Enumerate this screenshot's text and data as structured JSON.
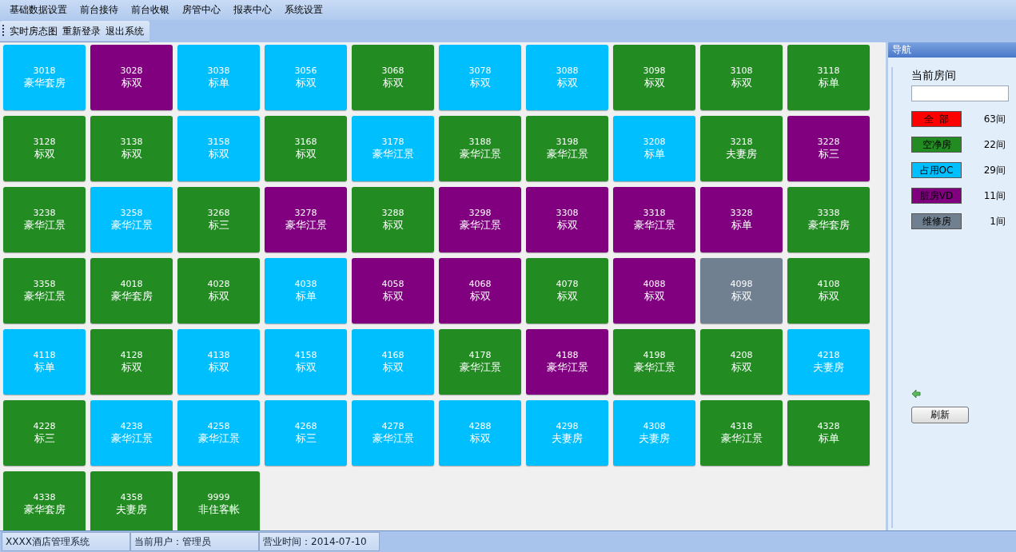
{
  "menu": [
    "基础数据设置",
    "前台接待",
    "前台收银",
    "房管中心",
    "报表中心",
    "系统设置"
  ],
  "toolbar": [
    "实时房态图",
    "重新登录",
    "退出系统"
  ],
  "rooms": [
    {
      "number": "3018",
      "type": "豪华套房",
      "kind": "occupied"
    },
    {
      "number": "3028",
      "type": "标双",
      "kind": "dirty"
    },
    {
      "number": "3038",
      "type": "标单",
      "kind": "occupied"
    },
    {
      "number": "3056",
      "type": "标双",
      "kind": "occupied"
    },
    {
      "number": "3068",
      "type": "标双",
      "kind": "clean"
    },
    {
      "number": "3078",
      "type": "标双",
      "kind": "occupied"
    },
    {
      "number": "3088",
      "type": "标双",
      "kind": "occupied"
    },
    {
      "number": "3098",
      "type": "标双",
      "kind": "clean"
    },
    {
      "number": "3108",
      "type": "标双",
      "kind": "clean"
    },
    {
      "number": "3118",
      "type": "标单",
      "kind": "clean"
    },
    {
      "number": "3128",
      "type": "标双",
      "kind": "clean"
    },
    {
      "number": "3138",
      "type": "标双",
      "kind": "clean"
    },
    {
      "number": "3158",
      "type": "标双",
      "kind": "occupied"
    },
    {
      "number": "3168",
      "type": "标双",
      "kind": "clean"
    },
    {
      "number": "3178",
      "type": "豪华江景",
      "kind": "occupied"
    },
    {
      "number": "3188",
      "type": "豪华江景",
      "kind": "clean"
    },
    {
      "number": "3198",
      "type": "豪华江景",
      "kind": "clean"
    },
    {
      "number": "3208",
      "type": "标单",
      "kind": "occupied"
    },
    {
      "number": "3218",
      "type": "夫妻房",
      "kind": "clean"
    },
    {
      "number": "3228",
      "type": "标三",
      "kind": "dirty"
    },
    {
      "number": "3238",
      "type": "豪华江景",
      "kind": "clean"
    },
    {
      "number": "3258",
      "type": "豪华江景",
      "kind": "occupied"
    },
    {
      "number": "3268",
      "type": "标三",
      "kind": "clean"
    },
    {
      "number": "3278",
      "type": "豪华江景",
      "kind": "dirty"
    },
    {
      "number": "3288",
      "type": "标双",
      "kind": "clean"
    },
    {
      "number": "3298",
      "type": "豪华江景",
      "kind": "dirty"
    },
    {
      "number": "3308",
      "type": "标双",
      "kind": "dirty"
    },
    {
      "number": "3318",
      "type": "豪华江景",
      "kind": "dirty"
    },
    {
      "number": "3328",
      "type": "标单",
      "kind": "dirty"
    },
    {
      "number": "3338",
      "type": "豪华套房",
      "kind": "clean"
    },
    {
      "number": "3358",
      "type": "豪华江景",
      "kind": "clean"
    },
    {
      "number": "4018",
      "type": "豪华套房",
      "kind": "clean"
    },
    {
      "number": "4028",
      "type": "标双",
      "kind": "clean"
    },
    {
      "number": "4038",
      "type": "标单",
      "kind": "occupied"
    },
    {
      "number": "4058",
      "type": "标双",
      "kind": "dirty"
    },
    {
      "number": "4068",
      "type": "标双",
      "kind": "dirty"
    },
    {
      "number": "4078",
      "type": "标双",
      "kind": "clean"
    },
    {
      "number": "4088",
      "type": "标双",
      "kind": "dirty"
    },
    {
      "number": "4098",
      "type": "标双",
      "kind": "repair"
    },
    {
      "number": "4108",
      "type": "标双",
      "kind": "clean"
    },
    {
      "number": "4118",
      "type": "标单",
      "kind": "occupied"
    },
    {
      "number": "4128",
      "type": "标双",
      "kind": "clean"
    },
    {
      "number": "4138",
      "type": "标双",
      "kind": "occupied"
    },
    {
      "number": "4158",
      "type": "标双",
      "kind": "occupied"
    },
    {
      "number": "4168",
      "type": "标双",
      "kind": "occupied"
    },
    {
      "number": "4178",
      "type": "豪华江景",
      "kind": "clean"
    },
    {
      "number": "4188",
      "type": "豪华江景",
      "kind": "dirty"
    },
    {
      "number": "4198",
      "type": "豪华江景",
      "kind": "clean"
    },
    {
      "number": "4208",
      "type": "标双",
      "kind": "clean"
    },
    {
      "number": "4218",
      "type": "夫妻房",
      "kind": "occupied"
    },
    {
      "number": "4228",
      "type": "标三",
      "kind": "clean"
    },
    {
      "number": "4238",
      "type": "豪华江景",
      "kind": "occupied"
    },
    {
      "number": "4258",
      "type": "豪华江景",
      "kind": "occupied"
    },
    {
      "number": "4268",
      "type": "标三",
      "kind": "occupied"
    },
    {
      "number": "4278",
      "type": "豪华江景",
      "kind": "occupied"
    },
    {
      "number": "4288",
      "type": "标双",
      "kind": "occupied"
    },
    {
      "number": "4298",
      "type": "夫妻房",
      "kind": "occupied"
    },
    {
      "number": "4308",
      "type": "夫妻房",
      "kind": "occupied"
    },
    {
      "number": "4318",
      "type": "豪华江景",
      "kind": "clean"
    },
    {
      "number": "4328",
      "type": "标单",
      "kind": "clean"
    },
    {
      "number": "4338",
      "type": "豪华套房",
      "kind": "clean"
    },
    {
      "number": "4358",
      "type": "夫妻房",
      "kind": "clean"
    },
    {
      "number": "9999",
      "type": "非住客帐",
      "kind": "clean"
    }
  ],
  "navigation": {
    "title": "导航",
    "current_room_label": "当前房间",
    "legend": [
      {
        "label": "全  部",
        "color": "#ff0000",
        "count": "63间"
      },
      {
        "label": "空净房",
        "color": "#228b22",
        "count": "22间"
      },
      {
        "label": "占用OC",
        "color": "#00bfff",
        "count": "29间"
      },
      {
        "label": "脏房VD",
        "color": "#800080",
        "count": "11间"
      },
      {
        "label": "维修房",
        "color": "#708090",
        "count": "1间"
      }
    ],
    "refresh_button": "刷新"
  },
  "status_bar": [
    "XXXX酒店管理系统",
    "当前用户：管理员",
    "营业时间：2014-07-10"
  ]
}
